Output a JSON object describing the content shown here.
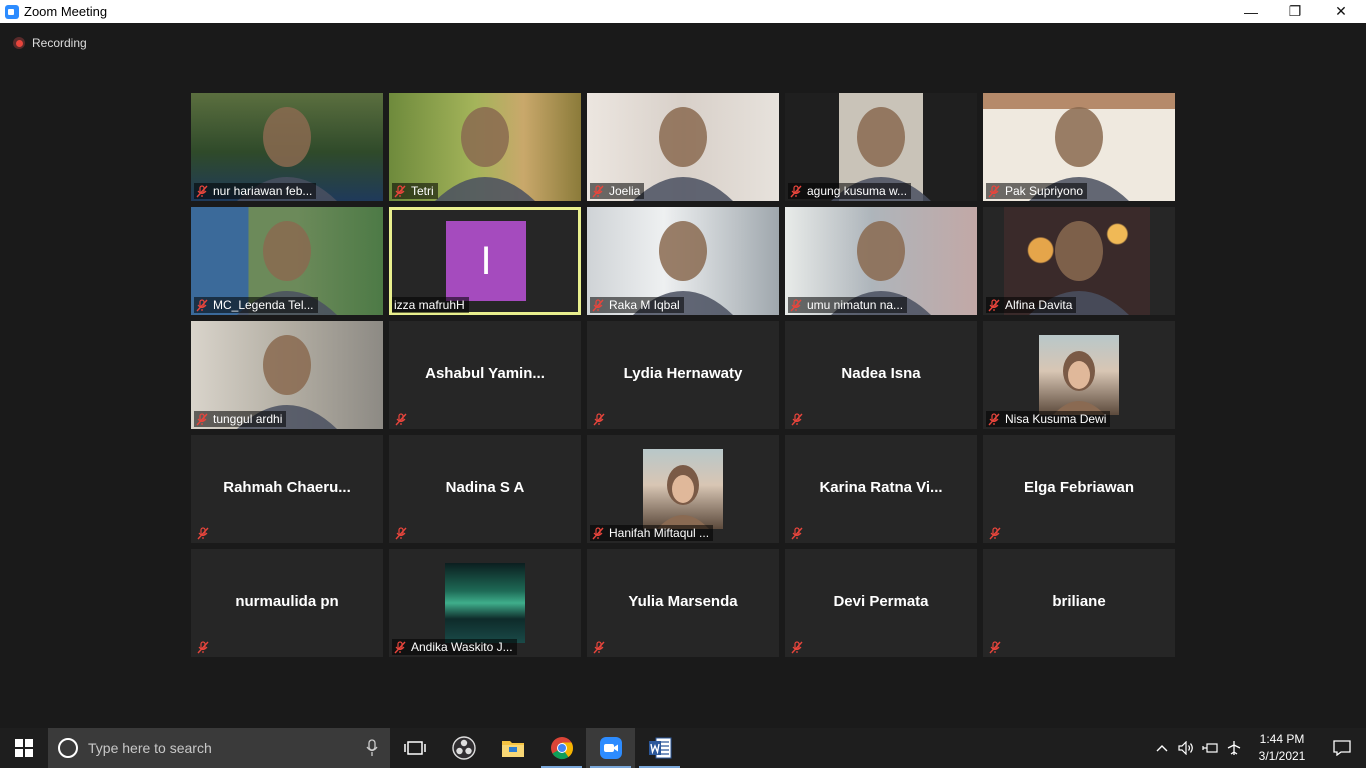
{
  "window": {
    "title": "Zoom Meeting",
    "minimize_glyph": "—",
    "restore_glyph": "❐",
    "close_glyph": "✕"
  },
  "recording": {
    "label": "Recording"
  },
  "participants": [
    {
      "name": "nur hariawan feb...",
      "video": true
    },
    {
      "name": "Tetri",
      "video": true
    },
    {
      "name": "Joelia",
      "video": true
    },
    {
      "name": "agung kusuma w...",
      "video": true
    },
    {
      "name": "Pak Supriyono",
      "video": true
    },
    {
      "name": "MC_Legenda Tel...",
      "video": true
    },
    {
      "name": "izza mafruhH",
      "video": false,
      "avatar_letter": "I",
      "avatar_color": "#a54bbe",
      "active_speaker": true
    },
    {
      "name": "Raka M Iqbal",
      "video": true
    },
    {
      "name": "umu nimatun na...",
      "video": true
    },
    {
      "name": "Alfina Davita",
      "video": true
    },
    {
      "name": "tunggul ardhi",
      "video": true
    },
    {
      "name": "Ashabul  Yamin...",
      "video": false
    },
    {
      "name": "Lydia Hernawaty",
      "video": false
    },
    {
      "name": "Nadea Isna",
      "video": false
    },
    {
      "name": "Nisa Kusuma Dewi",
      "video": false,
      "photo": true
    },
    {
      "name": "Rahmah  Chaeru...",
      "video": false
    },
    {
      "name": "Nadina S A",
      "video": false
    },
    {
      "name": "Hanifah Miftaqul ...",
      "video": false,
      "photo": true
    },
    {
      "name": "Karina  Ratna  Vi...",
      "video": false
    },
    {
      "name": "Elga Febriawan",
      "video": false
    },
    {
      "name": "nurmaulida pn",
      "video": false
    },
    {
      "name": "Andika Waskito J...",
      "video": false,
      "photo": true
    },
    {
      "name": "Yulia Marsenda",
      "video": false
    },
    {
      "name": "Devi Permata",
      "video": false
    },
    {
      "name": "briliane",
      "video": false
    }
  ],
  "taskbar": {
    "search_placeholder": "Type here to search",
    "apps": [
      "task-view",
      "obs",
      "file-explorer",
      "chrome",
      "zoom",
      "word"
    ],
    "clock_time": "1:44 PM",
    "clock_date": "3/1/2021"
  },
  "colors": {
    "mute_red": "#e8453c",
    "active_outline": "#e9ef8e",
    "tile_bg": "#262626"
  }
}
